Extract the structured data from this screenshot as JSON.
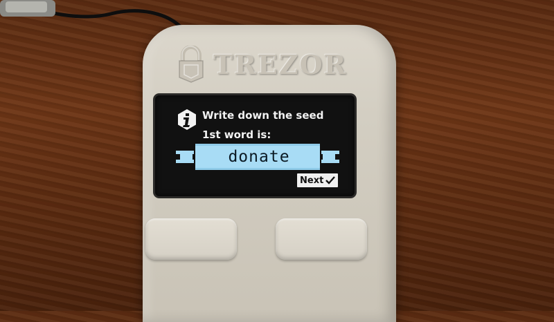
{
  "device": {
    "brand": "TREZOR"
  },
  "screen": {
    "title": "Write down the seed",
    "subtitle": "1st word is:",
    "seed_word": "donate",
    "next_label": "Next"
  },
  "icons": {
    "info": "info-icon",
    "check": "check-icon",
    "lock": "lock-icon"
  },
  "colors": {
    "wood": "#5c2c12",
    "device_body": "#d3cec2",
    "screen_bg": "#111111",
    "screen_text": "#f2f2f2",
    "banner": "#a8dcf5"
  }
}
